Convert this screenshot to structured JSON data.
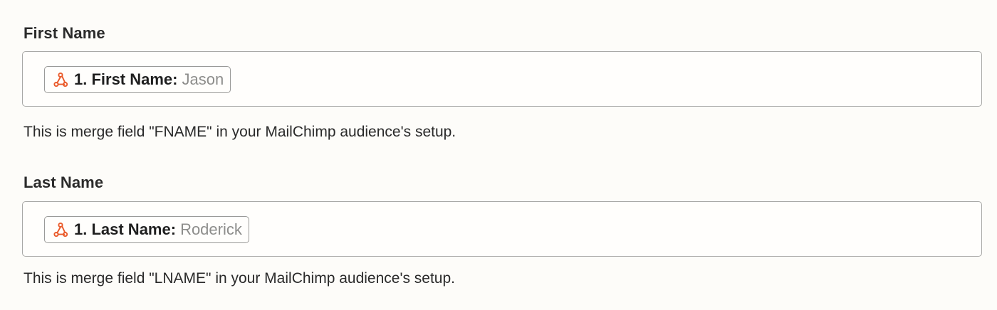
{
  "fields": [
    {
      "label": "First Name",
      "pill": {
        "icon": "webhook-icon",
        "key": "1. First Name:",
        "value": "Jason"
      },
      "help": "This is merge field \"FNAME\" in your MailChimp audience's setup."
    },
    {
      "label": "Last Name",
      "pill": {
        "icon": "webhook-icon",
        "key": "1. Last Name:",
        "value": "Roderick"
      },
      "help": "This is merge field \"LNAME\" in your MailChimp audience's setup."
    }
  ],
  "colors": {
    "icon_accent": "#ea5a2a",
    "border": "#a8a8a6",
    "value_text": "#8d8d8b",
    "background": "#fdfcf9"
  }
}
